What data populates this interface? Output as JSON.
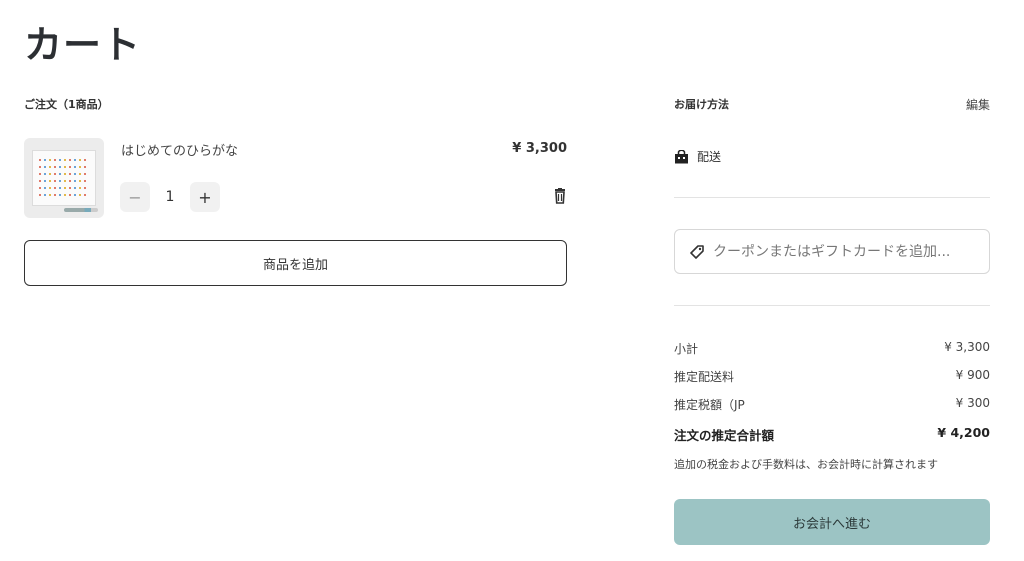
{
  "page": {
    "title": "カート"
  },
  "order": {
    "heading": "ご注文（1商品）",
    "items": [
      {
        "title": "はじめてのひらがな",
        "price": "¥ 3,300",
        "quantity": "1"
      }
    ],
    "qty_minus": "−",
    "qty_plus": "+",
    "add_product_label": "商品を追加"
  },
  "delivery": {
    "heading": "お届け方法",
    "edit_label": "編集",
    "method": "配送"
  },
  "coupon": {
    "placeholder": "クーポンまたはギフトカードを追加..."
  },
  "summary": {
    "subtotal_label": "小計",
    "subtotal": "¥ 3,300",
    "shipping_label": "推定配送料",
    "shipping": "¥ 900",
    "tax_label": "推定税額（JP",
    "tax": "¥ 300",
    "total_label": "注文の推定合計額",
    "total": "¥ 4,200",
    "note": "追加の税金および手数料は、お会計時に計算されます"
  },
  "checkout": {
    "label": "お会計へ進む",
    "color": "#9cc4c4"
  }
}
